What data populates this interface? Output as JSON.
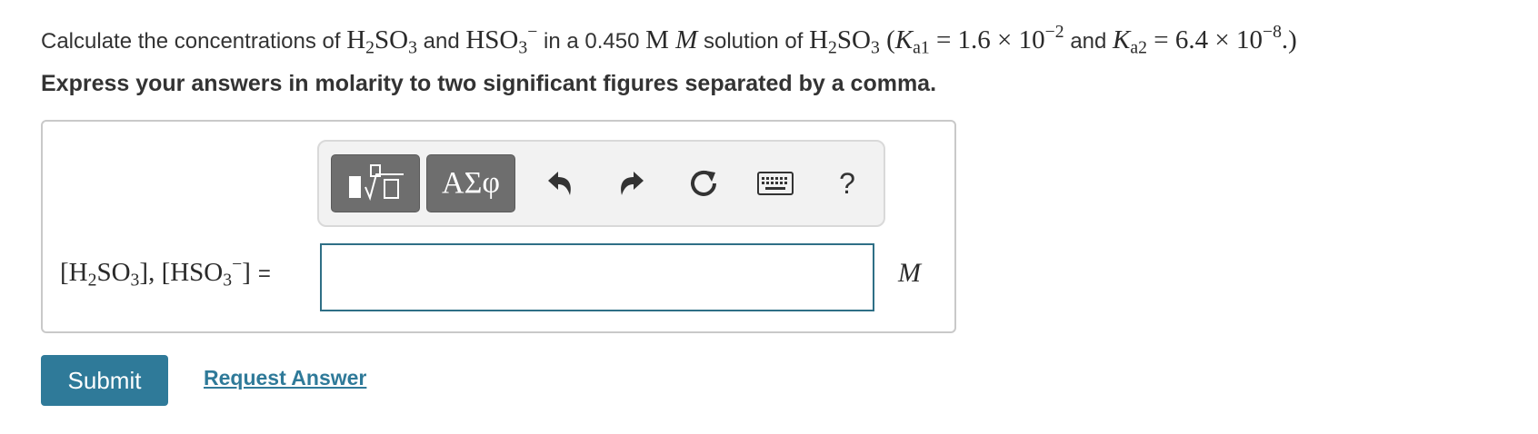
{
  "question": {
    "t1": "Calculate the concentrations of",
    "h2so3": "H",
    "sub2": "2",
    "so3": "SO",
    "sub3": "3",
    "t2": "and",
    "hso3": "HSO",
    "hso3_sub": "3",
    "hso3_charge": "−",
    "t3": "in a 0.450",
    "unit_M": "M",
    "unit_M_italic": "M",
    "t4": "solution of",
    "paren_open": "(",
    "Ka1_K": "K",
    "Ka1_sub": "a1",
    "Ka1_val": "= 1.6 × 10",
    "Ka1_exp": "−2",
    "t5": "and",
    "Ka2_K": "K",
    "Ka2_sub": "a2",
    "Ka2_val": "= 6.4 × 10",
    "Ka2_exp": "−8",
    "paren_close": ".)"
  },
  "instruction": "Express your answers in molarity to two significant figures separated by a comma.",
  "toolbar": {
    "symbols_label": "ΑΣφ",
    "help_label": "?",
    "icons": [
      "templates-icon",
      "undo-icon",
      "redo-icon",
      "reset-icon",
      "keyboard-icon",
      "help-icon"
    ]
  },
  "answer": {
    "label_open1": "[H",
    "label_sub1": "2",
    "label_mid1": "SO",
    "label_sub2": "3",
    "label_close1": "],",
    "label_open2": "[HSO",
    "label_sub3": "3",
    "label_sup": "−",
    "label_close2": "]",
    "equals": "=",
    "input_value": "",
    "unit": "M"
  },
  "actions": {
    "submit_label": "Submit",
    "request_label": "Request Answer"
  },
  "colors": {
    "accent": "#2f7a99",
    "input_border": "#2f6f86",
    "toolbar_dark": "#6e6e6e"
  }
}
